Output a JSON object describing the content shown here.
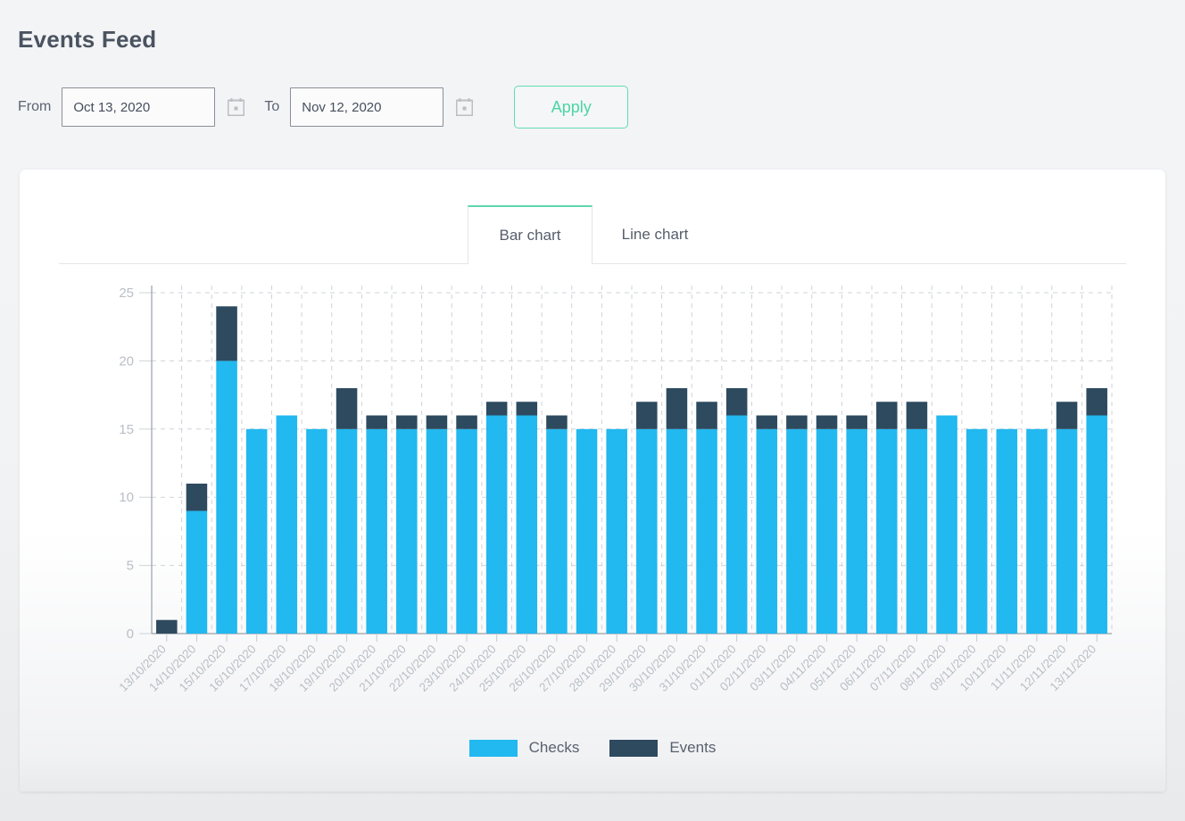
{
  "header": {
    "title": "Events Feed"
  },
  "filters": {
    "from_label": "From",
    "from_value": "Oct 13, 2020",
    "from_placeholder": "Oct 13, 2020",
    "to_label": "To",
    "to_value": "Nov 12, 2020",
    "to_placeholder": "Nov 12, 2020",
    "apply_label": "Apply",
    "calendar_icon": "calendar-icon"
  },
  "tabs": [
    {
      "label": "Bar chart",
      "active": true
    },
    {
      "label": "Line chart",
      "active": false
    }
  ],
  "colors": {
    "checks": "#22b8f0",
    "events": "#2d4a5f",
    "accent": "#5fd7ad",
    "grid": "#cfd3d8",
    "axis_text": "#b9bec6",
    "page_bg": "#f2f3f5",
    "card_bg": "#ffffff"
  },
  "chart_data": {
    "type": "bar",
    "title": "",
    "xlabel": "",
    "ylabel": "",
    "stacked": true,
    "grid": true,
    "legend_position": "bottom",
    "ylim": [
      0,
      25
    ],
    "yticks": [
      0,
      5,
      10,
      15,
      20,
      25
    ],
    "categories": [
      "13/10/2020",
      "14/10/2020",
      "15/10/2020",
      "16/10/2020",
      "17/10/2020",
      "18/10/2020",
      "19/10/2020",
      "20/10/2020",
      "21/10/2020",
      "22/10/2020",
      "23/10/2020",
      "24/10/2020",
      "25/10/2020",
      "26/10/2020",
      "27/10/2020",
      "28/10/2020",
      "29/10/2020",
      "30/10/2020",
      "31/10/2020",
      "01/11/2020",
      "02/11/2020",
      "03/11/2020",
      "04/11/2020",
      "05/11/2020",
      "06/11/2020",
      "07/11/2020",
      "08/11/2020",
      "09/11/2020",
      "10/11/2020",
      "11/11/2020",
      "12/11/2020",
      "13/11/2020"
    ],
    "series": [
      {
        "name": "Checks",
        "color": "#22b8f0",
        "values": [
          0,
          9,
          20,
          15,
          16,
          15,
          15,
          15,
          15,
          15,
          15,
          16,
          16,
          15,
          15,
          15,
          15,
          15,
          15,
          16,
          15,
          15,
          15,
          15,
          15,
          15,
          16,
          15,
          15,
          15,
          15,
          16
        ]
      },
      {
        "name": "Events",
        "color": "#2d4a5f",
        "values": [
          1,
          2,
          4,
          0,
          0,
          0,
          3,
          1,
          1,
          1,
          1,
          1,
          1,
          1,
          0,
          0,
          2,
          3,
          2,
          2,
          1,
          1,
          1,
          1,
          2,
          2,
          0,
          0,
          0,
          0,
          2,
          2
        ]
      }
    ],
    "totals": [
      1,
      11,
      24,
      15,
      16,
      15,
      18,
      16,
      16,
      16,
      16,
      17,
      17,
      16,
      15,
      15,
      17,
      18,
      17,
      18,
      16,
      16,
      16,
      16,
      17,
      17,
      16,
      15,
      15,
      15,
      17,
      18
    ]
  },
  "legend": [
    {
      "label": "Checks",
      "color": "#22b8f0"
    },
    {
      "label": "Events",
      "color": "#2d4a5f"
    }
  ]
}
